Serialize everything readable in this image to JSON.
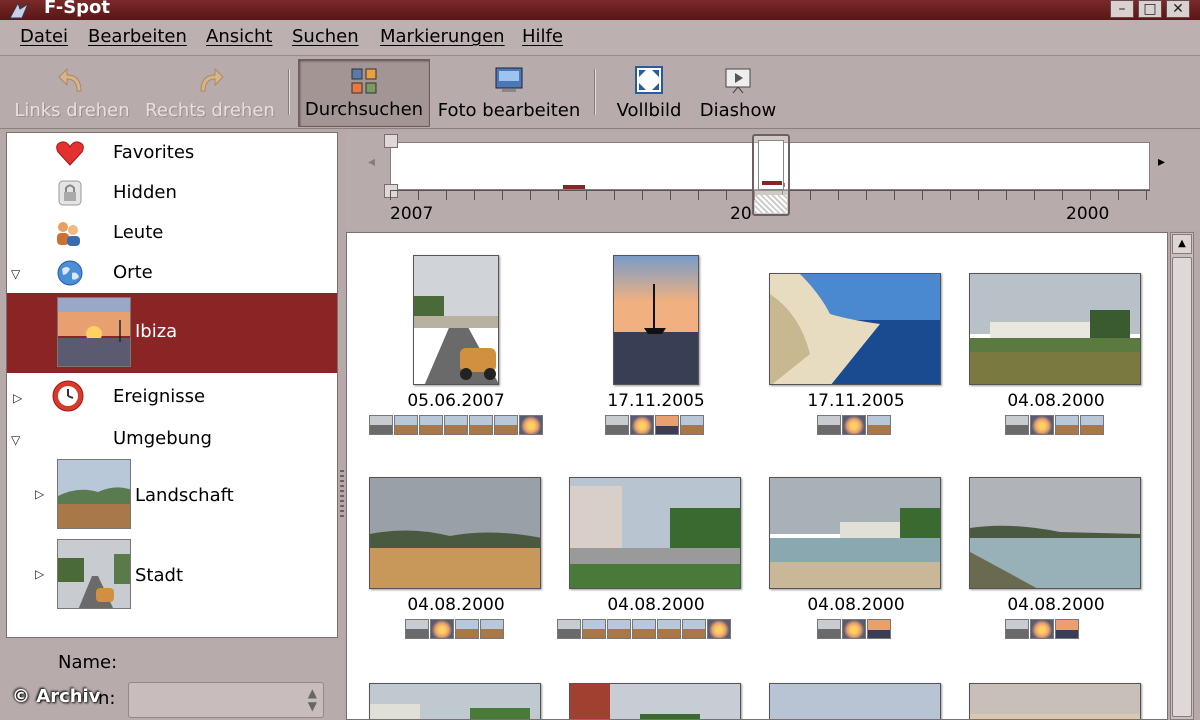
{
  "window": {
    "title": "F-Spot"
  },
  "menu": [
    "Datei",
    "Bearbeiten",
    "Ansicht",
    "Suchen",
    "Markierungen",
    "Hilfe"
  ],
  "toolbar": {
    "rotate_left": "Links drehen",
    "rotate_right": "Rechts drehen",
    "browse": "Durchsuchen",
    "edit_photo": "Foto bearbeiten",
    "fullscreen": "Vollbild",
    "slideshow": "Diashow"
  },
  "sidebar": {
    "favorites": "Favorites",
    "hidden": "Hidden",
    "people": "Leute",
    "places": "Orte",
    "ibiza": "Ibiza",
    "events": "Ereignisse",
    "surroundings": "Umgebung",
    "landscape": "Landschaft",
    "city": "Stadt"
  },
  "bottom_panel": {
    "name_label": "Name:",
    "icon_label_partial": "n:"
  },
  "watermark": "© Archiv",
  "timeline": {
    "years": [
      "2007",
      "2000"
    ],
    "partial_year": "20"
  },
  "photos": [
    {
      "date": "05.06.2007",
      "scene": "street"
    },
    {
      "date": "17.11.2005",
      "scene": "sunset-boat"
    },
    {
      "date": "17.11.2005",
      "scene": "cliff-sea"
    },
    {
      "date": "04.08.2000",
      "scene": "field-houses"
    },
    {
      "date": "04.08.2000",
      "scene": "dry-field"
    },
    {
      "date": "04.08.2000",
      "scene": "building-street"
    },
    {
      "date": "04.08.2000",
      "scene": "beach"
    },
    {
      "date": "04.08.2000",
      "scene": "coast"
    }
  ],
  "colors": {
    "selection": "#8b2525",
    "titlebar": "#6a1e1e",
    "chrome": "#b8abab"
  }
}
